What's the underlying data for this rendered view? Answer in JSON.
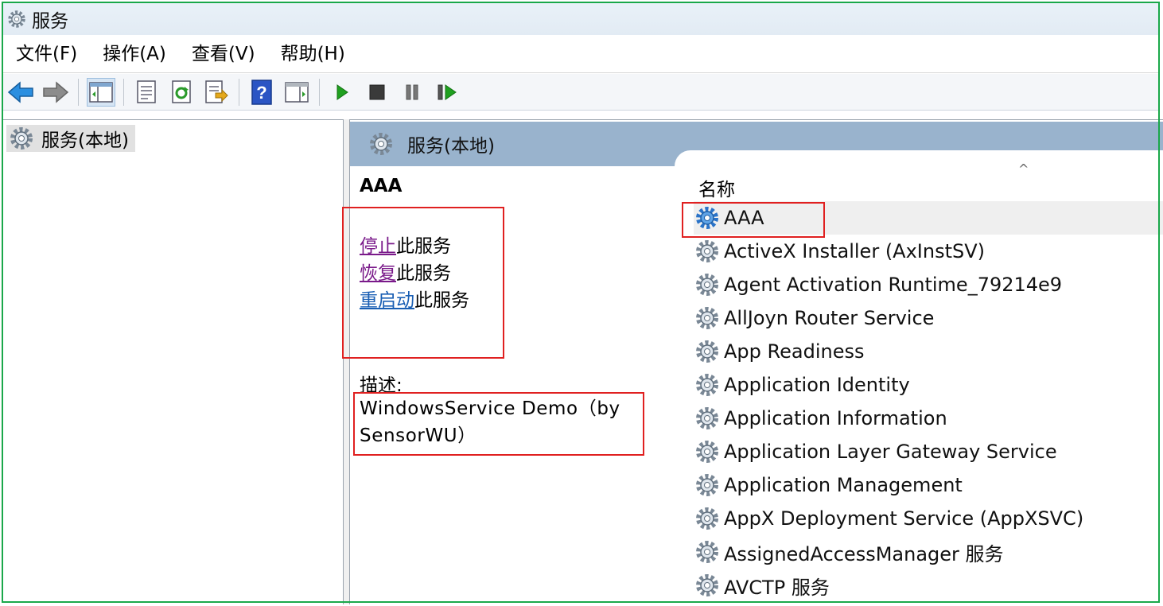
{
  "window": {
    "title": "服务"
  },
  "menu": [
    "文件(F)",
    "操作(A)",
    "查看(V)",
    "帮助(H)"
  ],
  "toolbar": {
    "buttons": [
      "back-icon",
      "forward-icon",
      "show-hide-tree-icon",
      "properties-icon",
      "refresh-icon",
      "export-list-icon",
      "help-icon",
      "view-icon",
      "start-service-icon",
      "stop-service-icon",
      "pause-service-icon",
      "restart-service-icon"
    ]
  },
  "tree": {
    "root_label": "服务(本地)"
  },
  "details_header": {
    "title": "服务(本地)"
  },
  "selected_service": {
    "name": "AAA",
    "actions": [
      {
        "link": "停止",
        "text": "此服务"
      },
      {
        "link": "恢复",
        "text": "此服务"
      },
      {
        "link": "重启动",
        "text": "此服务"
      }
    ],
    "description_label": "描述:",
    "description": "WindowsService Demo（by SensorWU）"
  },
  "services_list": {
    "column_name": "名称",
    "sort_indicator": "^",
    "rows": [
      "AAA",
      "ActiveX Installer (AxInstSV)",
      "Agent Activation Runtime_79214e9",
      "AllJoyn Router Service",
      "App Readiness",
      "Application Identity",
      "Application Information",
      "Application Layer Gateway Service",
      "Application Management",
      "AppX Deployment Service (AppXSVC)",
      "AssignedAccessManager 服务",
      "AVCTP 服务"
    ],
    "selected_index": 0
  },
  "colors": {
    "frame": "#1aa84a",
    "highlight": "#e02020",
    "header": "#99b3cd",
    "visited_link": "#7a1a8a",
    "link": "#1a5fb4"
  }
}
